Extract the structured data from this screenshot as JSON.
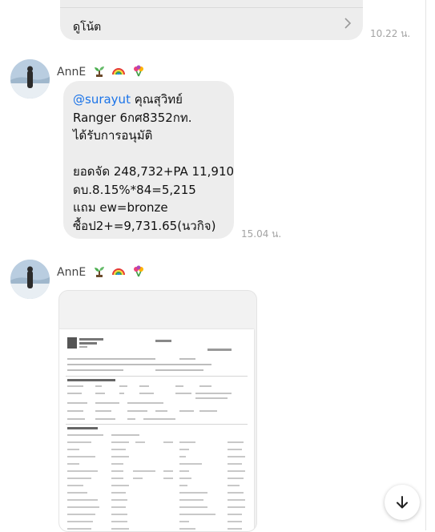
{
  "note_card": {
    "label": "ดูโน้ต",
    "time": "10.22 น."
  },
  "messages": [
    {
      "sender": "AnnE",
      "sender_emojis": [
        "sprout-emoji",
        "rainbow-emoji",
        "bouquet-emoji"
      ],
      "mention": "@surayut",
      "text_lines": [
        " คุณสุวิทย์",
        "Ranger 6กศ8352กท.",
        "ได้รับการอนุมัติ",
        "",
        "ยอดจัด 248,732+PA 11,910",
        "ดบ.8.15%*84=5,215",
        "แถม ew=bronze",
        "ซื้อป2+=9,731.65(นวกิจ)"
      ],
      "time": "15.04 น."
    },
    {
      "sender": "AnnE",
      "sender_emojis": [
        "sprout-emoji",
        "rainbow-emoji",
        "bouquet-emoji"
      ],
      "attachment": {
        "type": "image",
        "document_brand": "KIATNAKIN PHATRA"
      }
    }
  ],
  "colors": {
    "bubble": "#ededed",
    "mention": "#1a73e8",
    "time": "#a3a3a3"
  },
  "scroll_button_icon": "arrow-down-icon"
}
